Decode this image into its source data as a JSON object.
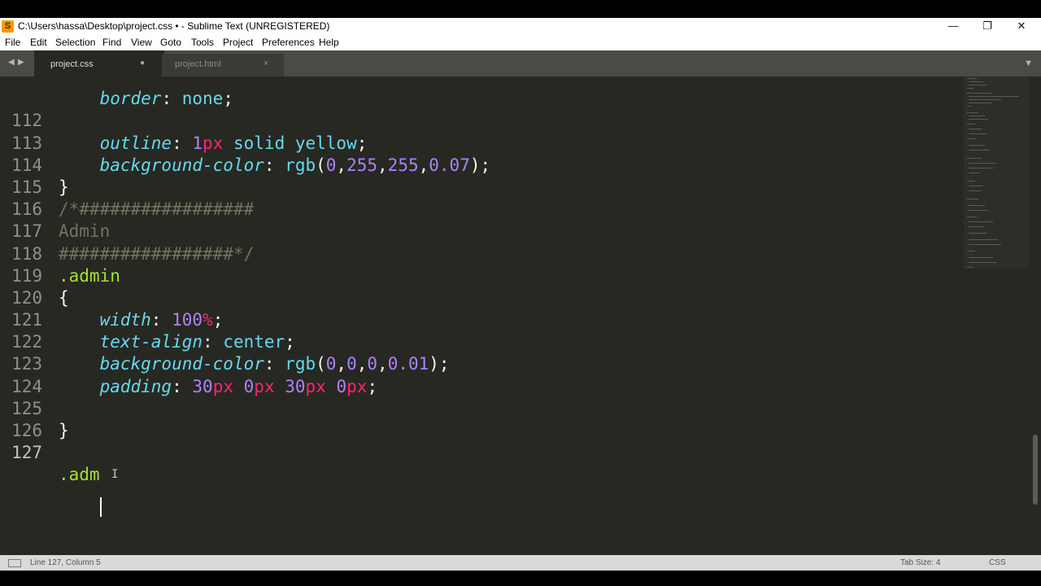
{
  "window": {
    "title": "C:\\Users\\hassa\\Desktop\\project.css • - Sublime Text (UNREGISTERED)",
    "app_icon": "sublime-text-logo",
    "controls": {
      "minimize": "—",
      "restore": "❐",
      "close": "✕"
    }
  },
  "menu": [
    "File",
    "Edit",
    "Selection",
    "Find",
    "View",
    "Goto",
    "Tools",
    "Project",
    "Preferences",
    "Help"
  ],
  "tabs": [
    {
      "label": "project.css",
      "active": true,
      "modified_dot": "●"
    },
    {
      "label": "project.html",
      "active": false,
      "close": "×"
    }
  ],
  "nav": {
    "back": "◀",
    "forward": "▶",
    "dropdown": "▼"
  },
  "code": {
    "partial_line": {
      "text": "border: none;"
    },
    "line_numbers": [
      "112",
      "113",
      "114",
      "115",
      "116",
      "117",
      "118",
      "119",
      "120",
      "121",
      "122",
      "123",
      "124",
      "125",
      "126",
      "127"
    ],
    "current_line": "127",
    "typed_text": ".adm"
  },
  "status": {
    "position": "Line 127, Column 5",
    "tab_size": "Tab Size: 4",
    "syntax": "CSS"
  },
  "colors": {
    "editor_bg": "#272822",
    "property": "#66d9ef",
    "number": "#ae81ff",
    "unit": "#f92672",
    "selector": "#a6e22e",
    "comment": "#75715e",
    "text": "#f8f8f2"
  }
}
